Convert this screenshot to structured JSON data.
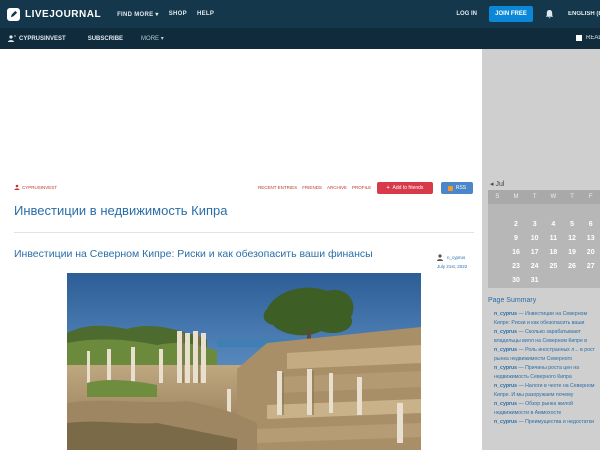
{
  "header": {
    "brand": "LIVEJOURNAL",
    "nav": [
      "FIND MORE ▾",
      "SHOP",
      "HELP"
    ],
    "login": "LOG IN",
    "join": "JOIN FREE",
    "language": "ENGLISH (EN)"
  },
  "subheader": {
    "journal": "CYPRUSINVEST",
    "subscribe": "SUBSCRIBE",
    "more": "MORE ▾",
    "read": "READER"
  },
  "journal": {
    "tag": "CYPRUSINVEST",
    "nav": [
      "RECENT ENTRIES",
      "FRIENDS",
      "ARCHIVE",
      "PROFILE"
    ],
    "add_friends": "Add to friends",
    "rss": "RSS",
    "title": "Инвестиции в недвижимость Кипра"
  },
  "post": {
    "title": "Инвестиции на Северном Кипре: Риски и как обезопасить ваши финансы",
    "author": "n_cyprus",
    "date": "July 21st, 2022"
  },
  "calendar": {
    "month": "Jul",
    "weekdays": [
      "S",
      "M",
      "T",
      "W",
      "T",
      "F"
    ],
    "rows": [
      [
        "",
        "",
        "",
        "",
        "",
        ""
      ],
      [
        "",
        "2",
        "3",
        "4",
        "5",
        "6"
      ],
      [
        "",
        "9",
        "10",
        "11",
        "12",
        "13"
      ],
      [
        "",
        "16",
        "17",
        "18",
        "19",
        "20"
      ],
      [
        "",
        "23",
        "24",
        "25",
        "26",
        "27"
      ],
      [
        "",
        "30",
        "31",
        "",
        "",
        ""
      ]
    ]
  },
  "summary": {
    "title": "Page Summary",
    "items": [
      {
        "user": "n_cyprus",
        "text": " — Инвестиции на Северном Кипре: Риски и как обезопасить ваши"
      },
      {
        "user": "n_cyprus",
        "text": " — Сколько зарабатывают владельцы вилл на Северном Кипре в аренду?"
      },
      {
        "user": "n_cyprus",
        "text": " — Роль иностранных л... в рост рынка недвижимости Северного"
      },
      {
        "user": "n_cyprus",
        "text": " — Причины роста цен на недвижимость Северного Кипра"
      },
      {
        "user": "n_cyprus",
        "text": " — Налоги в чехте на Северном Кипре. И мы разоружаем почему"
      },
      {
        "user": "n_cyprus",
        "text": " — Обзор рынка жилой недвижимости в Аммохосте"
      },
      {
        "user": "n_cyprus",
        "text": " — Преимущества и недостатки"
      }
    ]
  },
  "colors": {
    "topbar": "#15374c",
    "subbar": "#0f2b3c",
    "join": "#0c86d6",
    "link": "#2b6ea8",
    "sidebar": "#cfcfcf"
  }
}
